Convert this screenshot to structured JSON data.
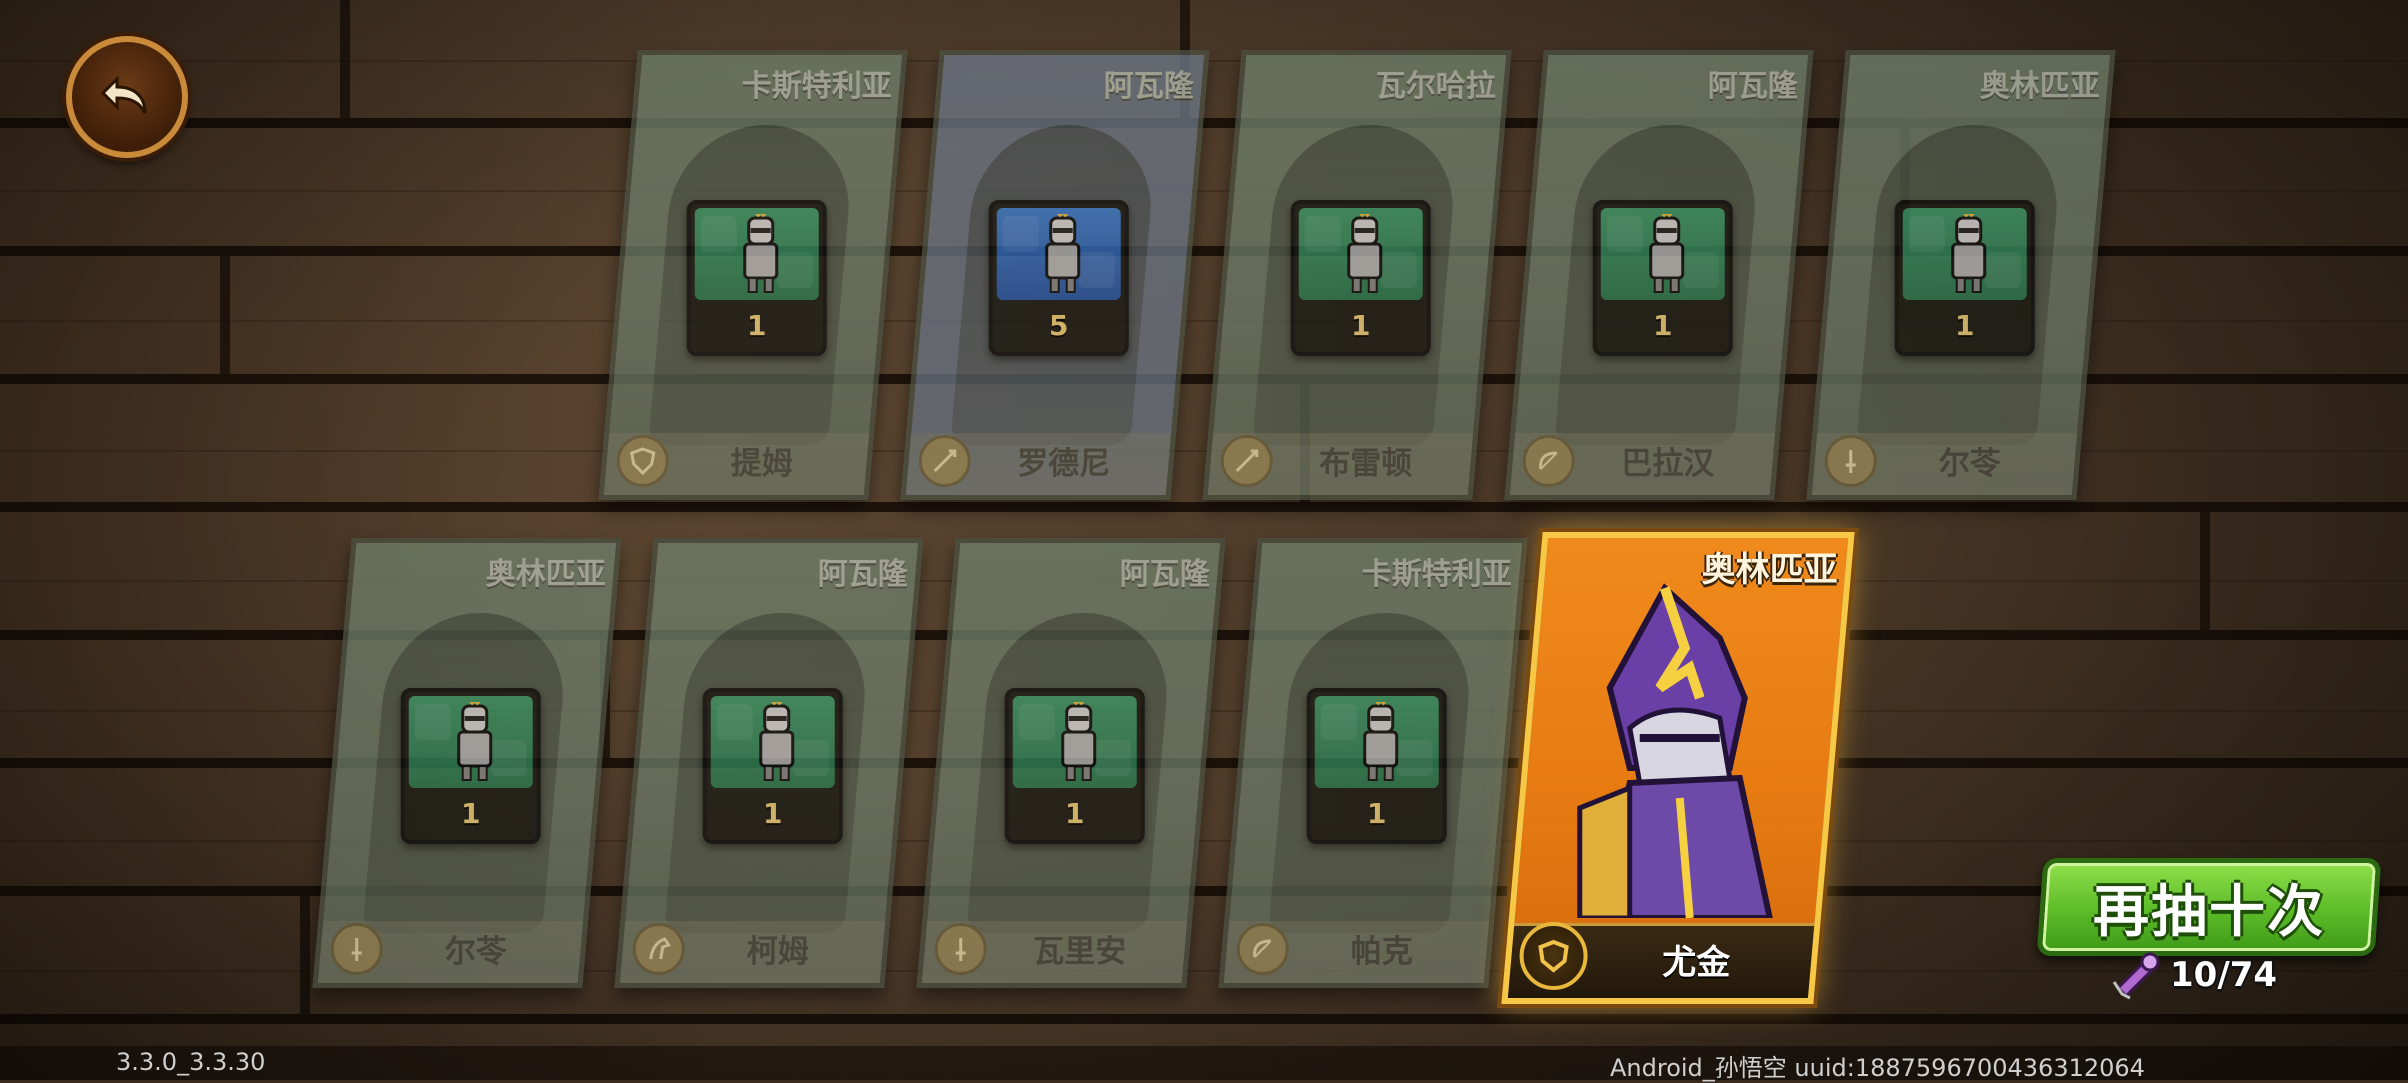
{
  "back_button": {
    "icon": "undo-arrow-icon"
  },
  "cards_row1": [
    {
      "faction": "卡斯特利亚",
      "name": "提姆",
      "count": "1",
      "class_icon": "shield-icon",
      "color": "green"
    },
    {
      "faction": "阿瓦隆",
      "name": "罗德尼",
      "count": "5",
      "class_icon": "spear-icon",
      "color": "blue"
    },
    {
      "faction": "瓦尔哈拉",
      "name": "布雷顿",
      "count": "1",
      "class_icon": "spear-icon",
      "color": "green"
    },
    {
      "faction": "阿瓦隆",
      "name": "巴拉汉",
      "count": "1",
      "class_icon": "bow-icon",
      "color": "green"
    },
    {
      "faction": "奥林匹亚",
      "name": "尔苓",
      "count": "1",
      "class_icon": "sword-icon",
      "color": "green"
    }
  ],
  "cards_row2": [
    {
      "faction": "奥林匹亚",
      "name": "尔苓",
      "count": "1",
      "class_icon": "sword-icon",
      "color": "green"
    },
    {
      "faction": "阿瓦隆",
      "name": "柯姆",
      "count": "1",
      "class_icon": "horse-icon",
      "color": "green"
    },
    {
      "faction": "阿瓦隆",
      "name": "瓦里安",
      "count": "1",
      "class_icon": "sword-icon",
      "color": "green"
    },
    {
      "faction": "卡斯特利亚",
      "name": "帕克",
      "count": "1",
      "class_icon": "bow-icon",
      "color": "green"
    }
  ],
  "featured_card": {
    "faction": "奥林匹亚",
    "name": "尤金",
    "class_icon": "shield-icon",
    "background": "#e77b12"
  },
  "redraw_button": {
    "label": "再抽十次"
  },
  "cost": {
    "icon": "scroll-icon",
    "text": "10/74"
  },
  "footer": {
    "version": "3.3.0_3.3.30",
    "uid": "Android_孙悟空 uuid:1887596700436312064"
  }
}
